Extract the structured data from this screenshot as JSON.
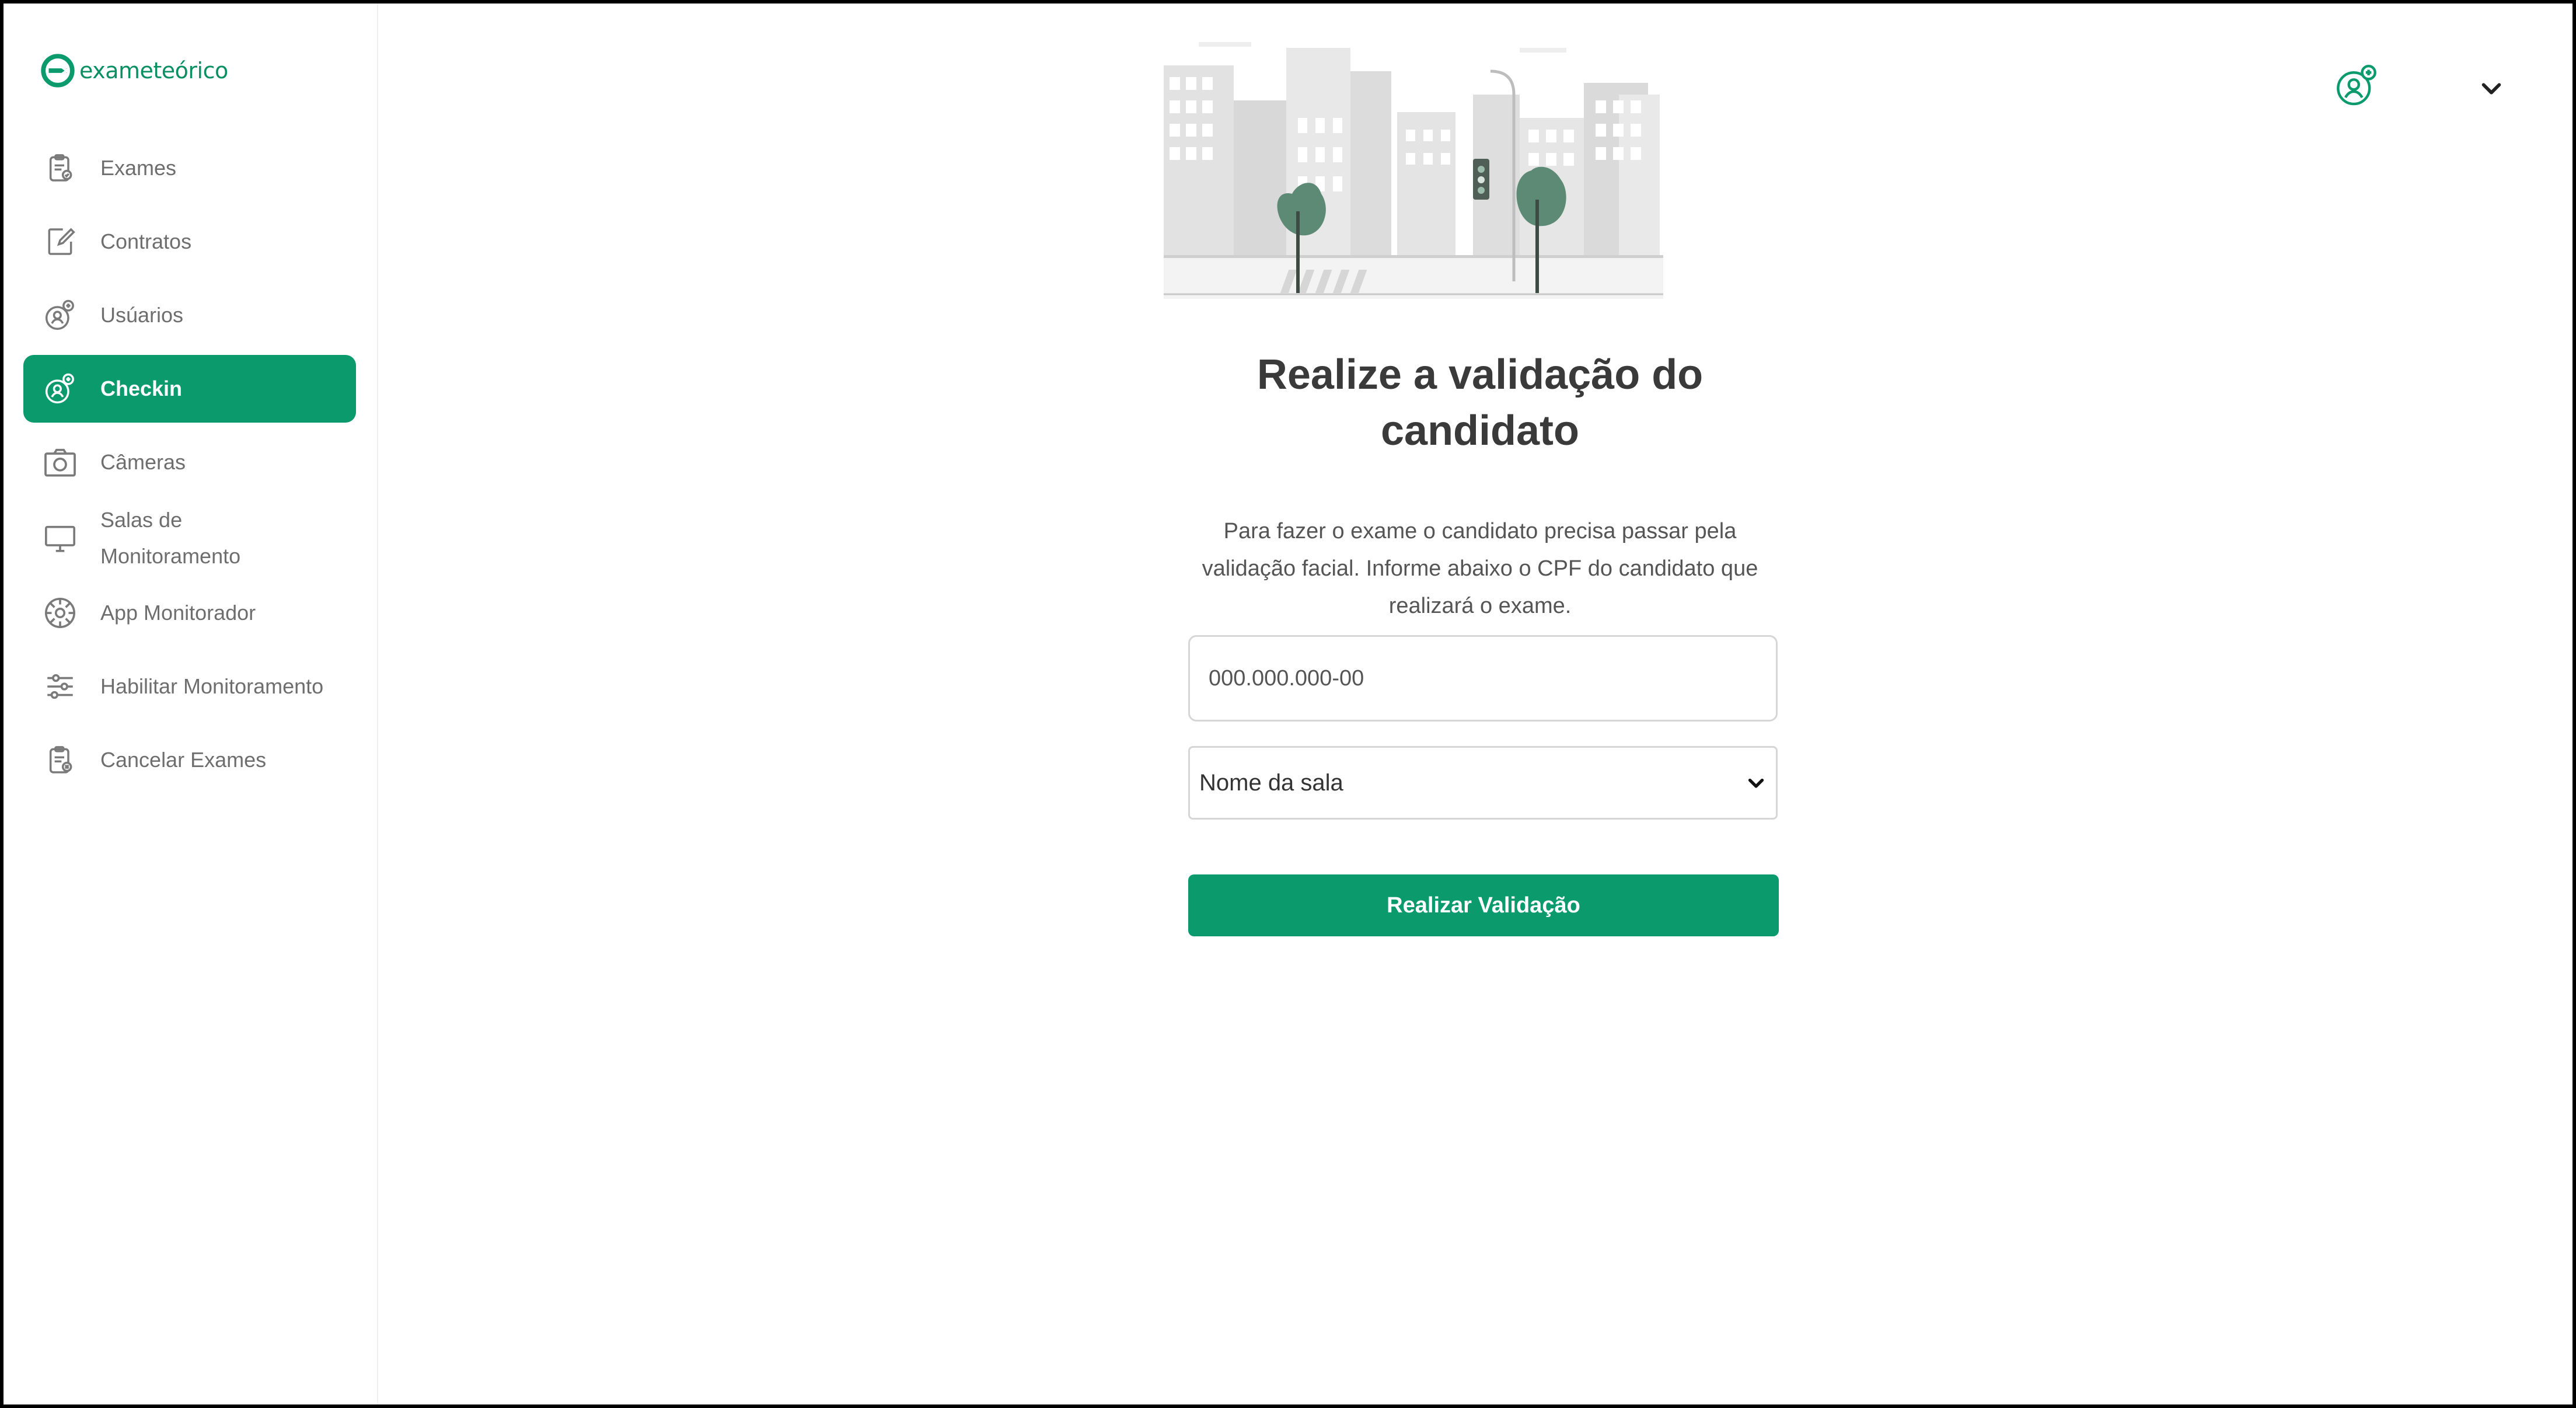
{
  "brand": {
    "name": "exameteórico",
    "color": "#0a9a6b"
  },
  "sidebar": {
    "items": [
      {
        "label": "Exames",
        "icon": "clipboard-icon"
      },
      {
        "label": "Contratos",
        "icon": "document-edit-icon"
      },
      {
        "label": "Usúarios",
        "icon": "user-add-icon"
      },
      {
        "label": "Checkin",
        "icon": "user-check-icon",
        "active": true
      },
      {
        "label": "Câmeras",
        "icon": "camera-icon"
      },
      {
        "label_line1": "Salas de",
        "label_line2": "Monitoramento",
        "icon": "monitor-icon"
      },
      {
        "label": "App Monitorador",
        "icon": "app-icon"
      },
      {
        "label": "Habilitar Monitoramento",
        "icon": "sliders-icon"
      },
      {
        "label": "Cancelar Exames",
        "icon": "clipboard-cancel-icon"
      }
    ]
  },
  "header": {
    "avatar_icon": "user-avatar-icon",
    "menu_icon": "chevron-down-icon"
  },
  "main": {
    "illustration": "city-street-illustration",
    "title": "Realize a validação do candidato",
    "description": "Para fazer o exame o candidato precisa passar pela validação facial. Informe abaixo o CPF do candidato que realizará o exame.",
    "cpf_placeholder": "000.000.000-00",
    "sala_selected": "Nome da sala",
    "submit_label": "Realizar Validação"
  }
}
